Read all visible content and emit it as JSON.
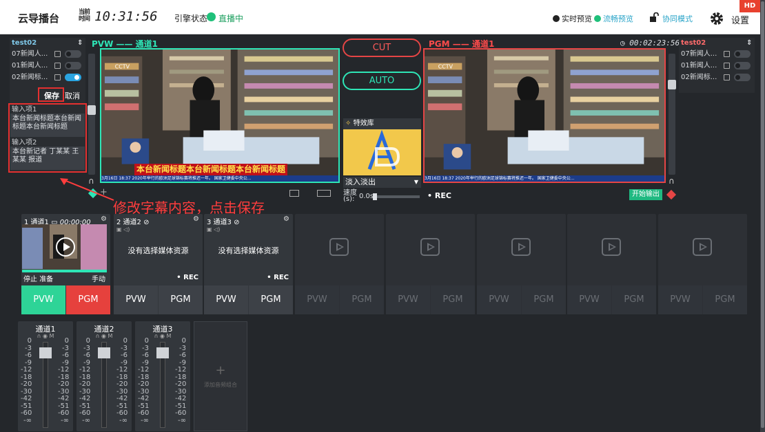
{
  "header": {
    "app_title": "云导播台",
    "clock_icon_text": "当前\n时间",
    "clock": "10:31:56",
    "stream_status_label": "引擎状态",
    "stream_status_value": "直播中",
    "realtime_preview": "实时预览",
    "smooth_preview": "流畅预览",
    "collab_mode": "协同模式",
    "settings": "设置",
    "hd_badge": "HD"
  },
  "left_panel": {
    "title": "test02",
    "items": [
      {
        "label": "07新闻人...",
        "on": false
      },
      {
        "label": "01新闻人...",
        "on": false
      },
      {
        "label": "02新闻标...",
        "on": true
      }
    ],
    "save": "保存",
    "cancel": "取消",
    "input1_label": "输入项1",
    "input1_value": "本台新闻标题本台新闻标题本台新闻标题",
    "input2_label": "输入项2",
    "input2_value": "本台新记者 丁某某 王某某 报道"
  },
  "preview": {
    "label": "PVW —— 通道1",
    "caption": "本台新闻标题本台新闻标题本台新闻标题",
    "crawl": "3月16日 18:37  2020年举行的欧洲足球锦标赛将推迟一年。  国家卫健委中央公...",
    "logo": "CCTV"
  },
  "program": {
    "label": "PGM —— 通道1",
    "timer": "00:02:23:56",
    "crawl": "3月16日 18:37  2020年举行的欧洲足球锦标赛将推迟一年。  国家卫健委中央公...",
    "logo": "CCTV",
    "rec": "• REC",
    "output_button": "开始输出"
  },
  "switcher": {
    "cut": "CUT",
    "auto": "AUTO",
    "fx_library": "特效库",
    "transition": "淡入淡出",
    "speed_label": "速度(s):",
    "speed_value": "0.0s"
  },
  "right_panel": {
    "title": "test02",
    "items": [
      {
        "label": "07新闻人...",
        "on": false
      },
      {
        "label": "01新闻人...",
        "on": false
      },
      {
        "label": "02新闻标...",
        "on": false
      }
    ]
  },
  "annotation": "修改字幕内容，点击保存",
  "channels": [
    {
      "title": "1 通道1",
      "time": "00:00:00",
      "stop": "停止",
      "ready": "准备",
      "manual": "手动",
      "pvw": "PVW",
      "pgm": "PGM"
    },
    {
      "title": "2 通道2",
      "no_media": "没有选择媒体资源",
      "rec": "• REC",
      "pvw": "PVW",
      "pgm": "PGM"
    },
    {
      "title": "3 通道3",
      "no_media": "没有选择媒体资源",
      "rec": "• REC",
      "pvw": "PVW",
      "pgm": "PGM"
    },
    {
      "pvw": "PVW",
      "pgm": "PGM"
    },
    {
      "pvw": "PVW",
      "pgm": "PGM"
    },
    {
      "pvw": "PVW",
      "pgm": "PGM"
    },
    {
      "pvw": "PVW",
      "pgm": "PGM"
    },
    {
      "pvw": "PVW",
      "pgm": "PGM"
    }
  ],
  "audio": {
    "mixers": [
      {
        "name": "通道1"
      },
      {
        "name": "通道2"
      },
      {
        "name": "通道3"
      }
    ],
    "scale": [
      "0",
      "-3",
      "-6",
      "-9",
      "-12",
      "-18",
      "-20",
      "-30",
      "-42",
      "-51",
      "-60",
      "-∞"
    ],
    "add_group": "添加音频组合"
  },
  "colors": {
    "pvw_accent": "#2ee6b7",
    "pgm_accent": "#e64545",
    "annotation_red": "#ff3d3d",
    "live_green": "#1fc07a"
  }
}
